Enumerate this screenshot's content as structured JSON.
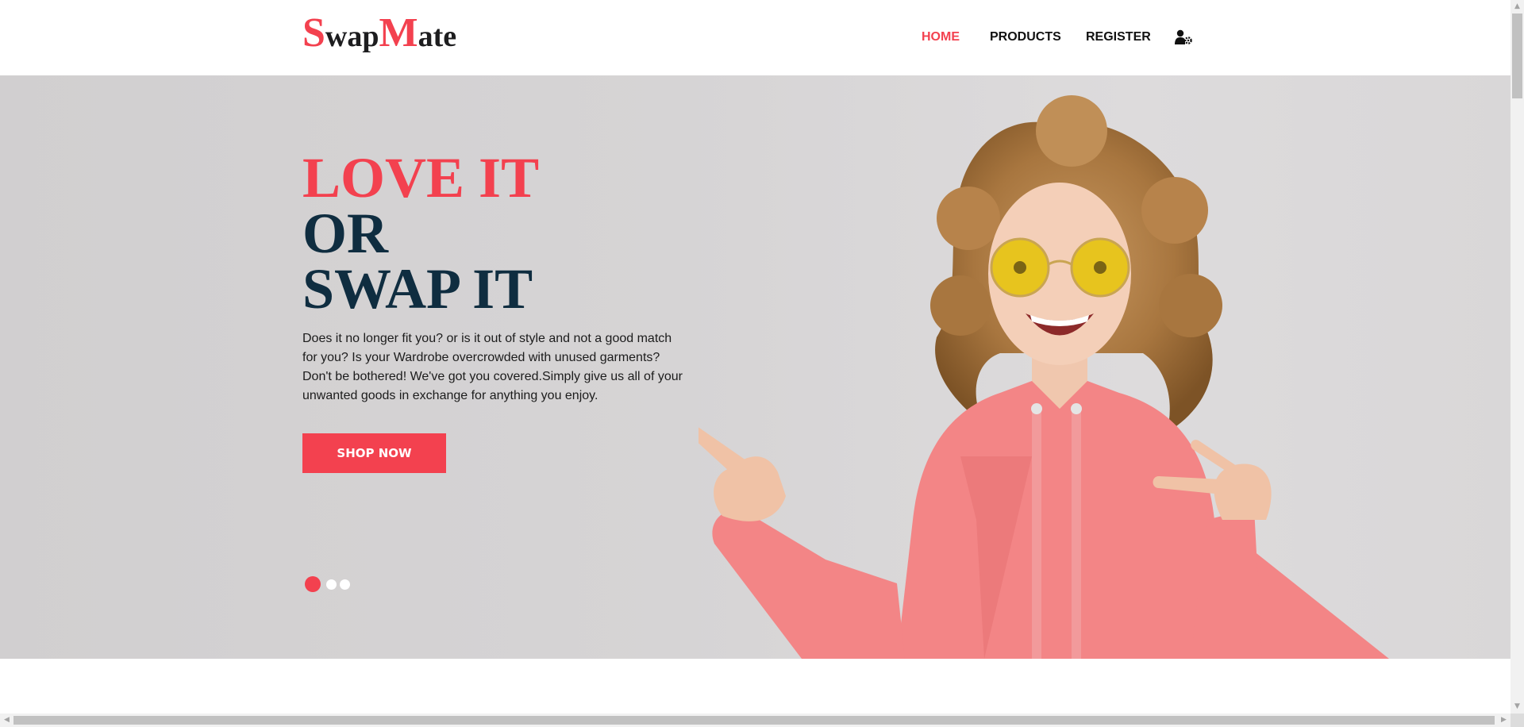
{
  "brand": {
    "first_cap": "S",
    "first_rest": "wap",
    "second_cap": "M",
    "second_rest": "ate",
    "color": "#f3414f"
  },
  "nav": {
    "home": "HOME",
    "products": "PRODUCTS",
    "register": "REGISTER",
    "account_icon": "user-gear-icon"
  },
  "hero": {
    "line1": "LOVE IT",
    "line2": "OR",
    "line3": "SWAP IT",
    "description": "Does it no longer fit you? or is it out of style and not a good match for you? Is your Wardrobe overcrowded with unused garments? Don't be bothered! We've got you covered.Simply give us all of your unwanted goods in exchange for anything you enjoy.",
    "cta": "SHOP NOW",
    "slides_total": 3,
    "active_slide": 1,
    "image": "woman-in-pink-hoodie-pointing"
  },
  "colors": {
    "accent": "#f3414f",
    "heading_dark": "#0f2d40",
    "hero_bg": "#d6d4d5"
  }
}
